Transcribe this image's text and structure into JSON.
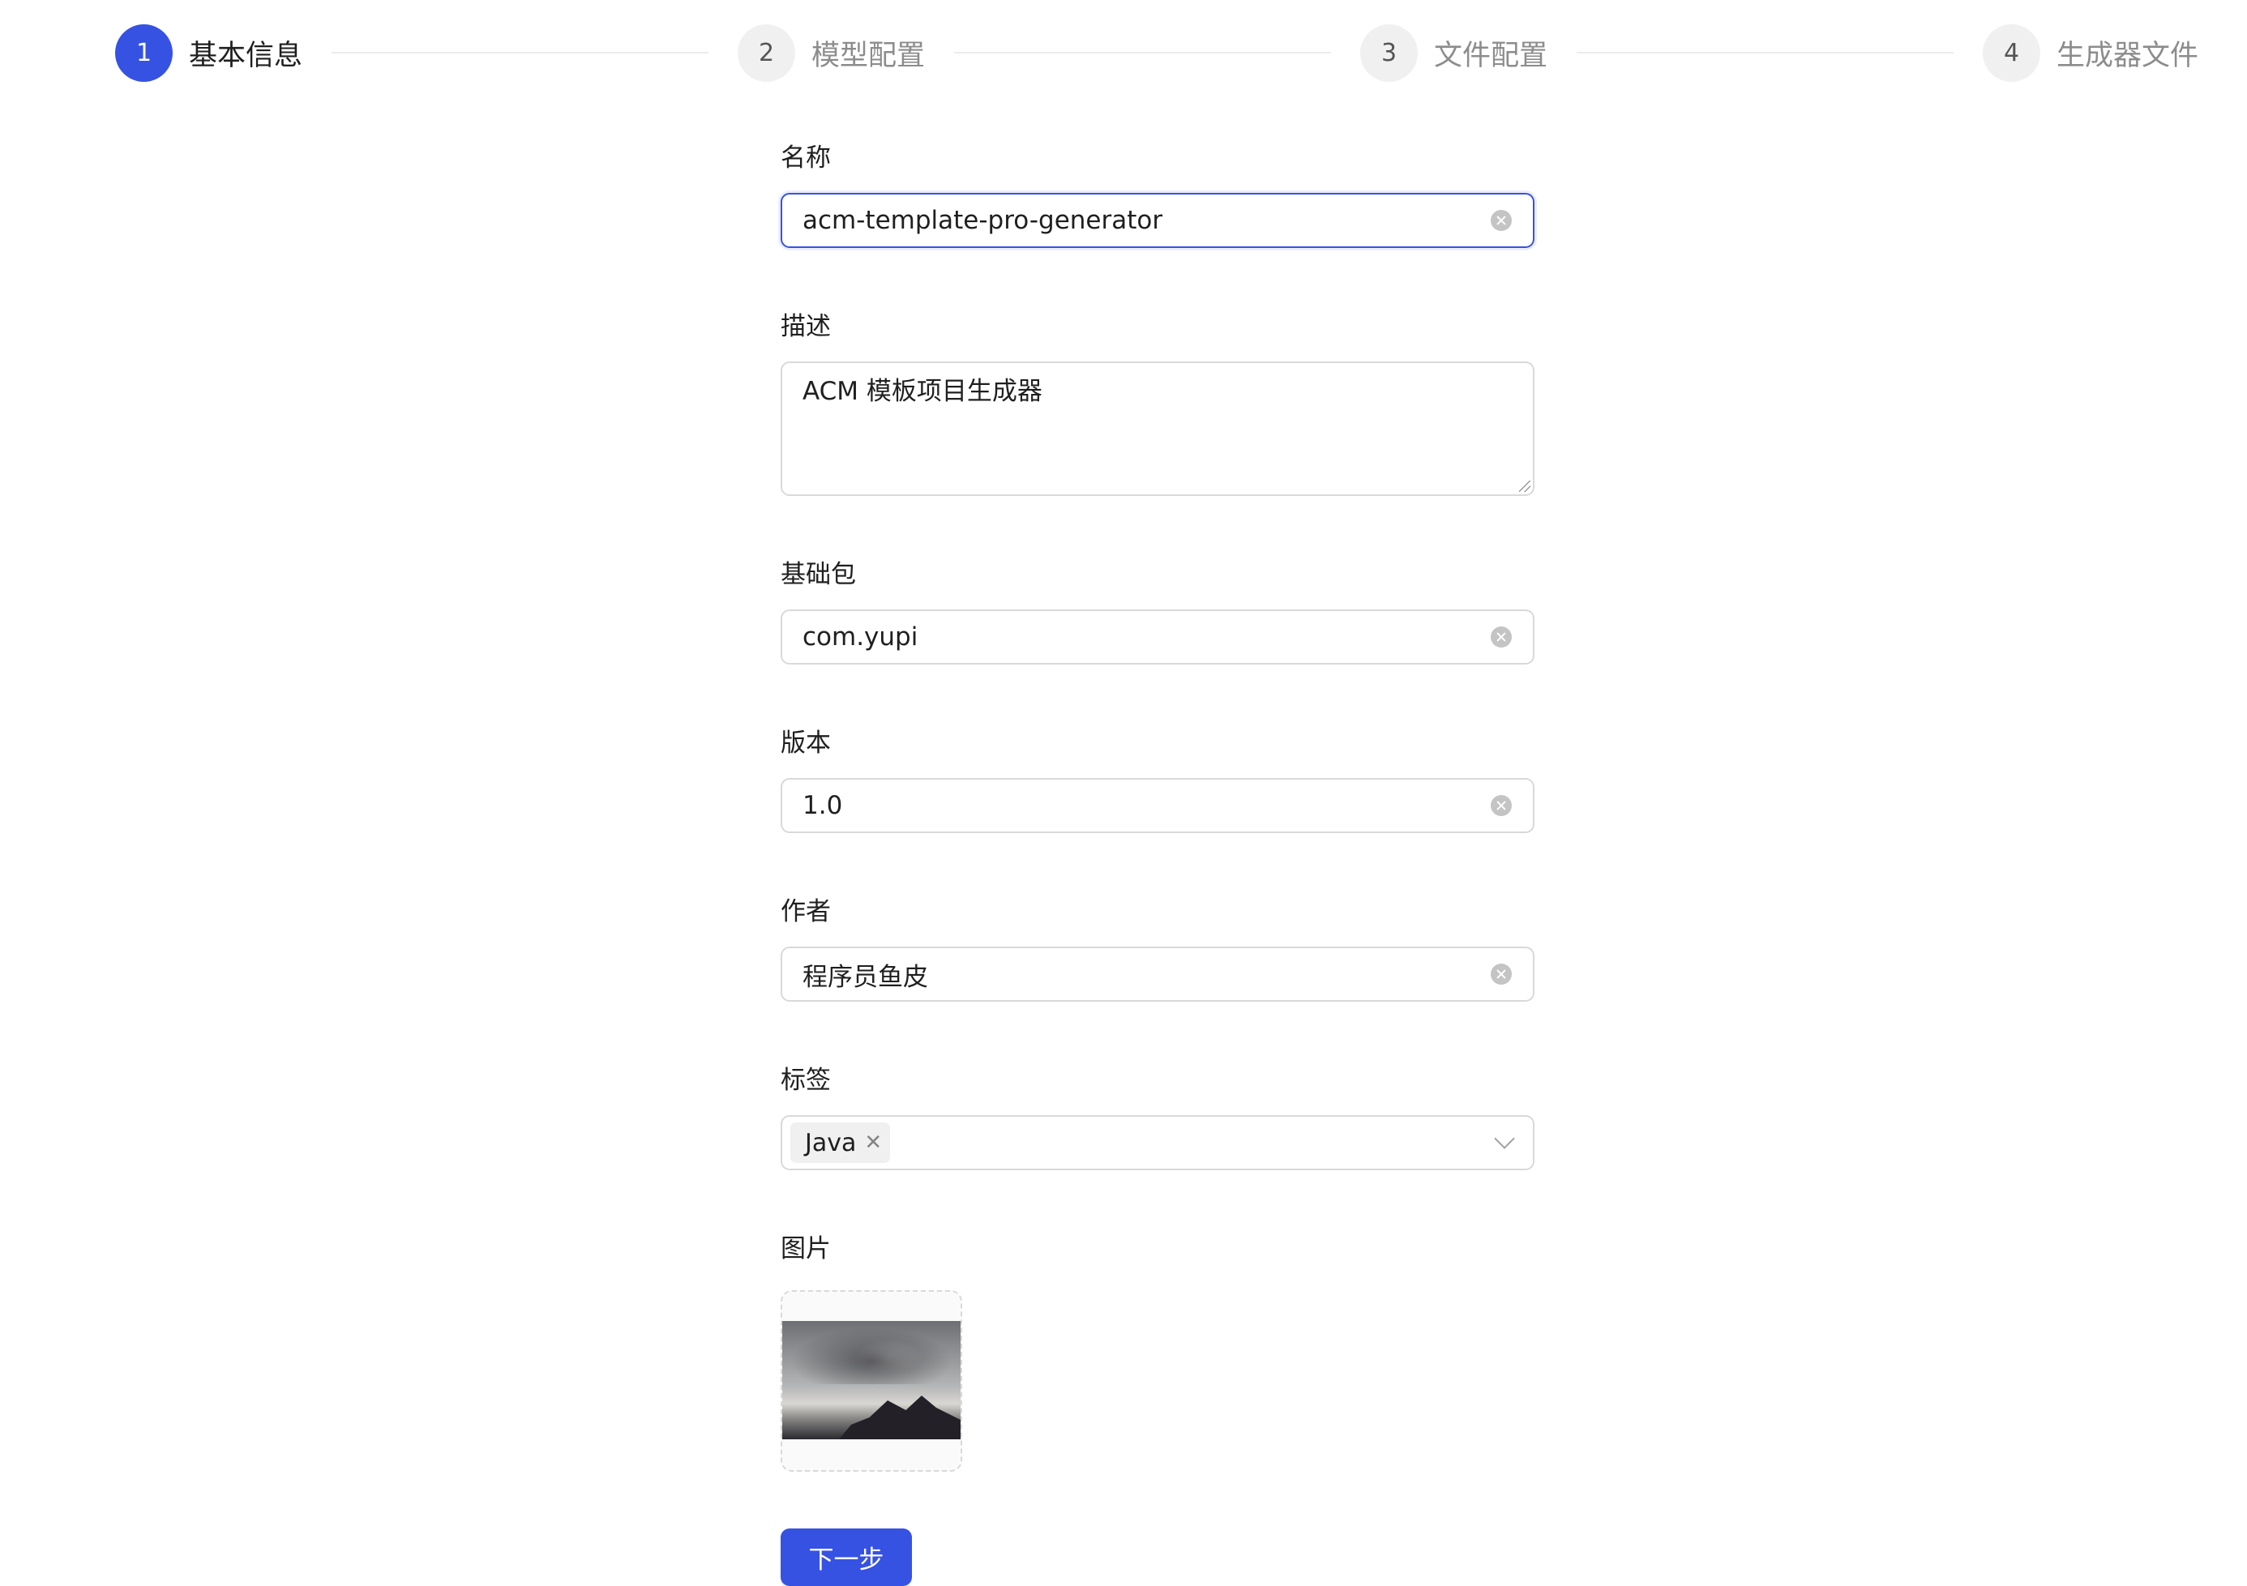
{
  "steps": [
    {
      "number": "1",
      "title": "基本信息",
      "active": true
    },
    {
      "number": "2",
      "title": "模型配置",
      "active": false
    },
    {
      "number": "3",
      "title": "文件配置",
      "active": false
    },
    {
      "number": "4",
      "title": "生成器文件",
      "active": false
    }
  ],
  "form": {
    "name": {
      "label": "名称",
      "value": "acm-template-pro-generator"
    },
    "description": {
      "label": "描述",
      "value": "ACM 模板项目生成器"
    },
    "base_package": {
      "label": "基础包",
      "value": "com.yupi"
    },
    "version": {
      "label": "版本",
      "value": "1.0"
    },
    "author": {
      "label": "作者",
      "value": "程序员鱼皮"
    },
    "tags": {
      "label": "标签",
      "items": [
        "Java"
      ]
    },
    "picture": {
      "label": "图片"
    },
    "next_button": "下一步"
  },
  "colors": {
    "primary": "#3652e3",
    "border": "#d9d9d9",
    "step_inactive_bg": "#f0f0f0"
  }
}
